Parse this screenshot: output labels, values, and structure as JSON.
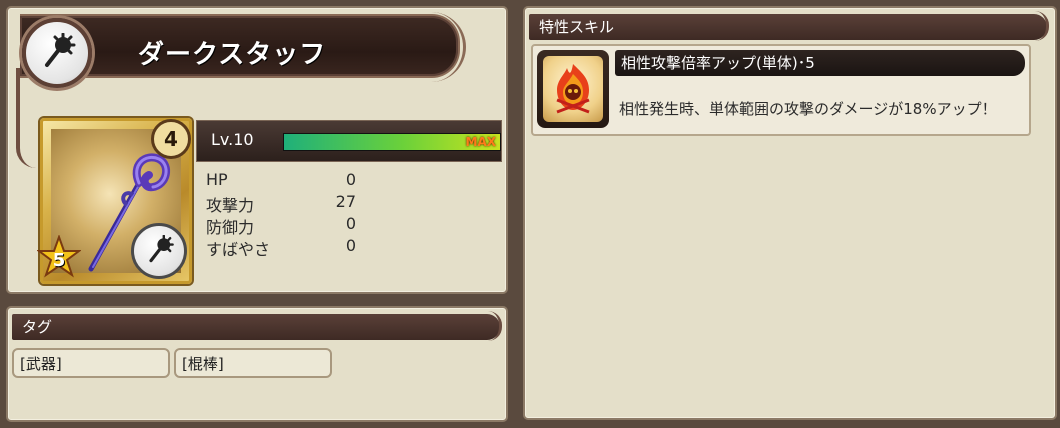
{
  "weapon": {
    "name": "ダークスタッフ",
    "rank": "4",
    "stars": "5",
    "emblem_icon": "mace-icon",
    "level_label": "Lv.10",
    "exp_max_label": "MAX",
    "exp_progress": 1.0
  },
  "stats": [
    {
      "label": "HP",
      "value": "0"
    },
    {
      "label": "攻撃力",
      "value": "27"
    },
    {
      "label": "防御力",
      "value": "0"
    },
    {
      "label": "すばやさ",
      "value": "0"
    }
  ],
  "tags": {
    "header": "タグ",
    "items": [
      "[武器]",
      "[棍棒]"
    ]
  },
  "skills": {
    "header": "特性スキル",
    "items": [
      {
        "title": "相性攻撃倍率アップ(単体)･5",
        "description": "相性発生時、単体範囲の攻撃のダメージが18%アップ！",
        "icon": "fire-skull-icon"
      }
    ]
  },
  "colors": {
    "panel_bg": "#e4dfc9",
    "header_bg": "#3e2a24",
    "exp_green": "#6bd13a",
    "max_orange": "#ff7a1a",
    "card_gold": "#d8b24a"
  }
}
